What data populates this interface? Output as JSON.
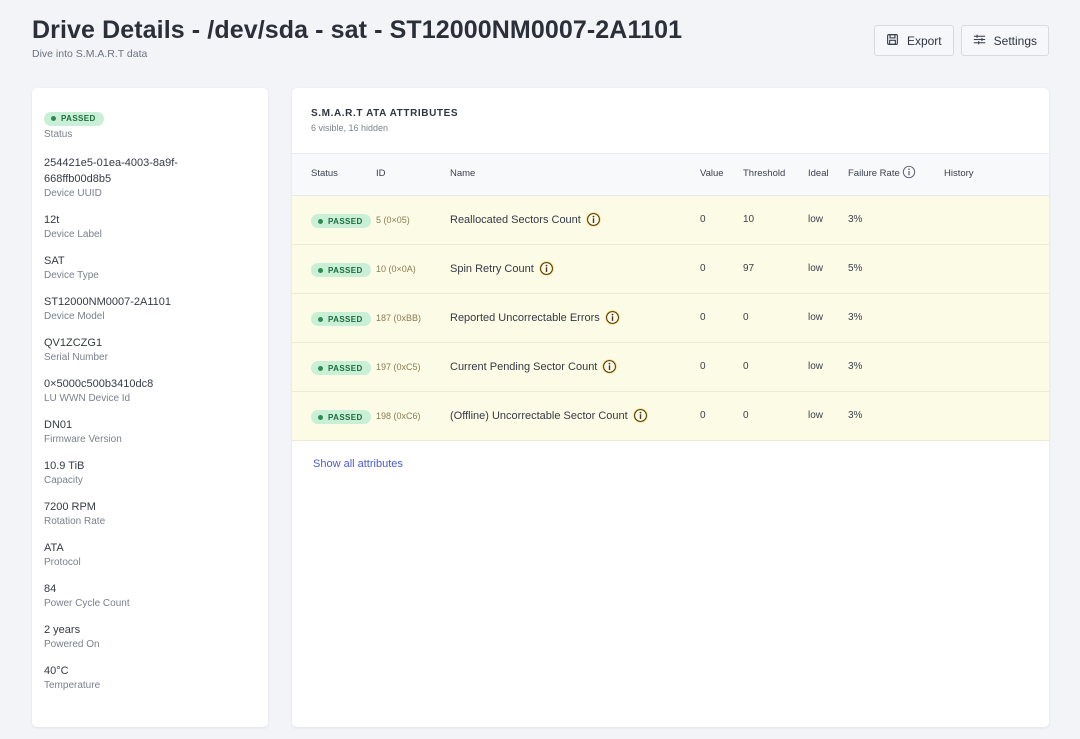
{
  "header": {
    "title": "Drive Details - /dev/sda - sat - ST12000NM0007-2A1101",
    "subtitle": "Dive into S.M.A.R.T data",
    "export_label": "Export",
    "settings_label": "Settings"
  },
  "sidebar": {
    "status_badge": "PASSED",
    "status_label": "Status",
    "properties": [
      {
        "value": "254421e5-01ea-4003-8a9f-668ffb00d8b5",
        "label": "Device UUID"
      },
      {
        "value": "12t",
        "label": "Device Label"
      },
      {
        "value": "SAT",
        "label": "Device Type"
      },
      {
        "value": "ST12000NM0007-2A1101",
        "label": "Device Model"
      },
      {
        "value": "QV1ZCZG1",
        "label": "Serial Number"
      },
      {
        "value": "0×5000c500b3410dc8",
        "label": "LU WWN Device Id"
      },
      {
        "value": "DN01",
        "label": "Firmware Version"
      },
      {
        "value": "10.9 TiB",
        "label": "Capacity"
      },
      {
        "value": "7200 RPM",
        "label": "Rotation Rate"
      },
      {
        "value": "ATA",
        "label": "Protocol"
      },
      {
        "value": "84",
        "label": "Power Cycle Count"
      },
      {
        "value": "2 years",
        "label": "Powered On"
      },
      {
        "value": "40°C",
        "label": "Temperature"
      }
    ]
  },
  "attributes": {
    "title": "S.M.A.R.T ATA ATTRIBUTES",
    "subtitle": "6 visible, 16 hidden",
    "columns": {
      "status": "Status",
      "id": "ID",
      "name": "Name",
      "value": "Value",
      "threshold": "Threshold",
      "ideal": "Ideal",
      "failure_rate": "Failure Rate",
      "history": "History"
    },
    "rows": [
      {
        "status": "PASSED",
        "id": "5 (0×05)",
        "name": "Reallocated Sectors Count",
        "value": "0",
        "threshold": "10",
        "ideal": "low",
        "failure_rate": "3%"
      },
      {
        "status": "PASSED",
        "id": "10 (0×0A)",
        "name": "Spin Retry Count",
        "value": "0",
        "threshold": "97",
        "ideal": "low",
        "failure_rate": "5%"
      },
      {
        "status": "PASSED",
        "id": "187 (0xBB)",
        "name": "Reported Uncorrectable Errors",
        "value": "0",
        "threshold": "0",
        "ideal": "low",
        "failure_rate": "3%"
      },
      {
        "status": "PASSED",
        "id": "197 (0xC5)",
        "name": "Current Pending Sector Count",
        "value": "0",
        "threshold": "0",
        "ideal": "low",
        "failure_rate": "3%"
      },
      {
        "status": "PASSED",
        "id": "198 (0xC6)",
        "name": "(Offline) Uncorrectable Sector Count",
        "value": "0",
        "threshold": "0",
        "ideal": "low",
        "failure_rate": "3%"
      }
    ],
    "show_all_label": "Show all attributes"
  },
  "colors": {
    "background": "#f2f4f8",
    "passed_badge_bg": "#c9f0d7",
    "passed_badge_text": "#1d6b3b",
    "row_highlight": "#fcfbe6",
    "link": "#4a5bd4"
  },
  "icons": {
    "export": "save-icon",
    "settings": "sliders-icon",
    "attribute_info": "info-icon"
  }
}
